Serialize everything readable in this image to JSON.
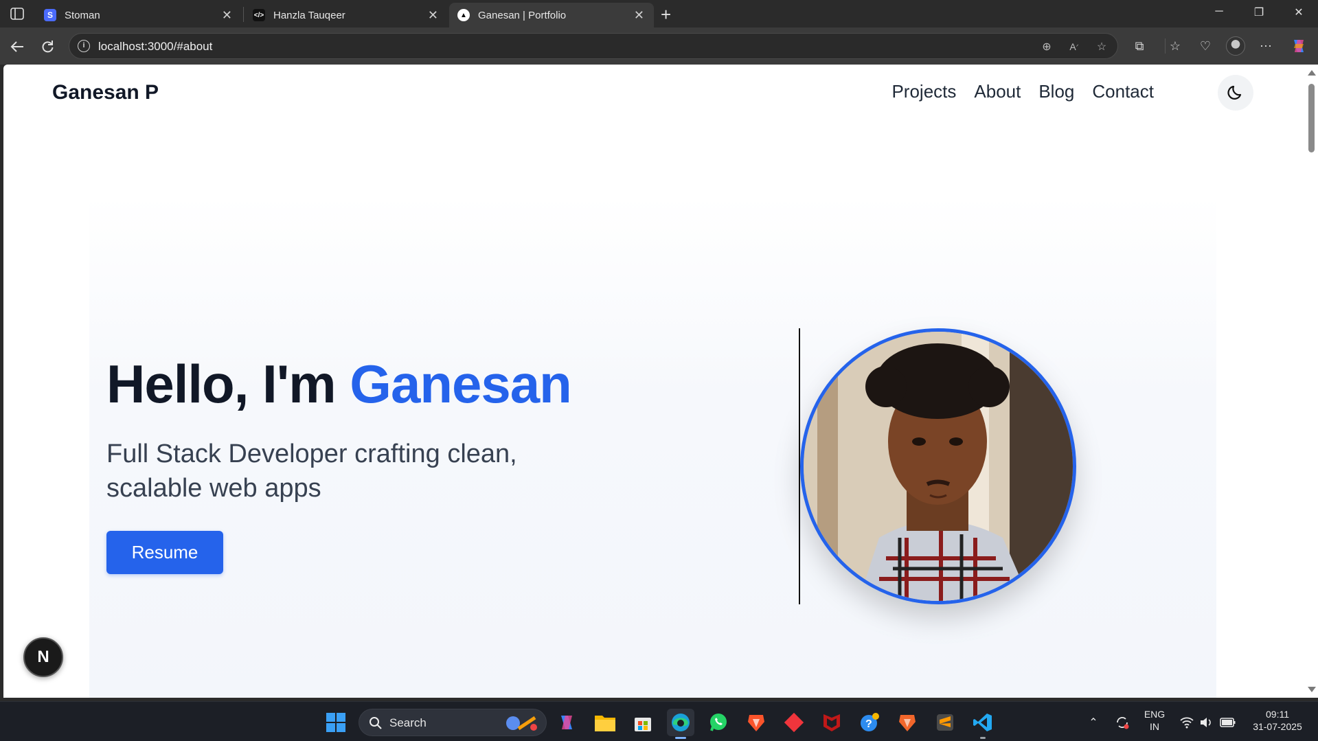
{
  "browser": {
    "tabs": [
      {
        "title": "Stoman",
        "favicon": "S"
      },
      {
        "title": "Hanzla Tauqeer",
        "favicon": "</>"
      },
      {
        "title": "Ganesan | Portfolio",
        "favicon": "▲"
      }
    ],
    "url": "localhost:3000/#about"
  },
  "site": {
    "brand": "Ganesan P",
    "nav": [
      "Projects",
      "About",
      "Blog",
      "Contact"
    ],
    "hero": {
      "greeting": "Hello, I'm ",
      "name": "Ganesan",
      "subtitle": "Full Stack Developer crafting clean, scalable web apps",
      "cta": "Resume"
    },
    "dev_badge": "N",
    "accent_color": "#2563eb"
  },
  "taskbar": {
    "search_label": "Search",
    "language": "ENG",
    "region": "IN",
    "time": "09:11",
    "date": "31-07-2025"
  }
}
